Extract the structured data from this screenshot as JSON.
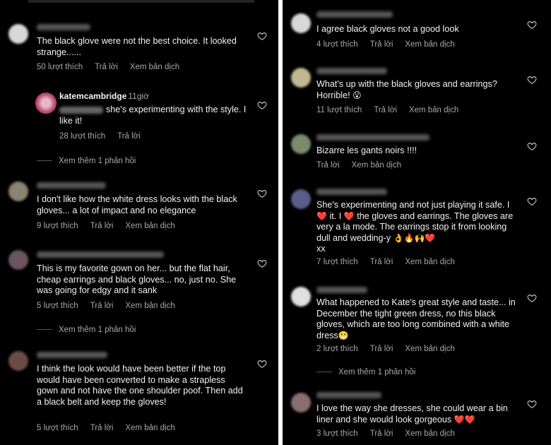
{
  "meta_labels": {
    "reply": "Trả lời",
    "translate": "Xem bản dịch"
  },
  "left": {
    "c1": {
      "text": "The black glove were not the best choice. It looked strange......",
      "likes": "50 lượt thích"
    },
    "reply1": {
      "author": "katemcambridge",
      "ago": "11giờ",
      "text": "she's experimenting with the style. I like it!",
      "likes": "28 lượt thích"
    },
    "more1": "Xem thêm 1 phản hồi",
    "c2": {
      "text": "I don't like how the white dress looks with the black gloves... a lot of impact and no elegance",
      "likes": "9 lượt thích"
    },
    "c3": {
      "text": "This is my favorite gown on her... but the flat hair, cheap earrings and black gloves... no, just no. She was going for edgy and it sank",
      "likes": "5 lượt thích"
    },
    "more2": "Xem thêm 1 phản hồi",
    "c4": {
      "text": "I think the look would have been better if the top would have been converted to make a strapless gown and not have the one shoulder poof. Then add a black belt and keep the gloves!",
      "likes": "5 lượt thích"
    }
  },
  "right": {
    "c1": {
      "text": "I agree black gloves not a good look",
      "likes": "4 lượt thích"
    },
    "c2": {
      "text": "What's up with the black gloves and earrings? Horrible!",
      "likes": "11 lượt thích"
    },
    "c3": {
      "text": "Bizarre les gants noirs !!!!"
    },
    "c4": {
      "text_a": "She's experimenting and not just playing it safe. I",
      "text_b": "it. I",
      "text_c": "the gloves and earrings. The gloves are very a la mode. The earrings stop it from looking dull and wedding-y",
      "text_d": "xx",
      "likes": "7 lượt thích"
    },
    "c5": {
      "text": "What happened to Kate's great style and taste... in December the tight green dress, no this black gloves, which are too long combined with a white dress",
      "likes": "2 lượt thích"
    },
    "more1": "Xem thêm 1 phản hồi",
    "c6": {
      "text": "I love the way she dresses, she could wear a bin liner and she would look gorgeous",
      "likes": "3 lượt thích"
    }
  },
  "colors": {
    "background": "#000000",
    "text": "#f2f2f2",
    "meta": "#a8a8a8",
    "heart_emoji": "#e0245e"
  }
}
